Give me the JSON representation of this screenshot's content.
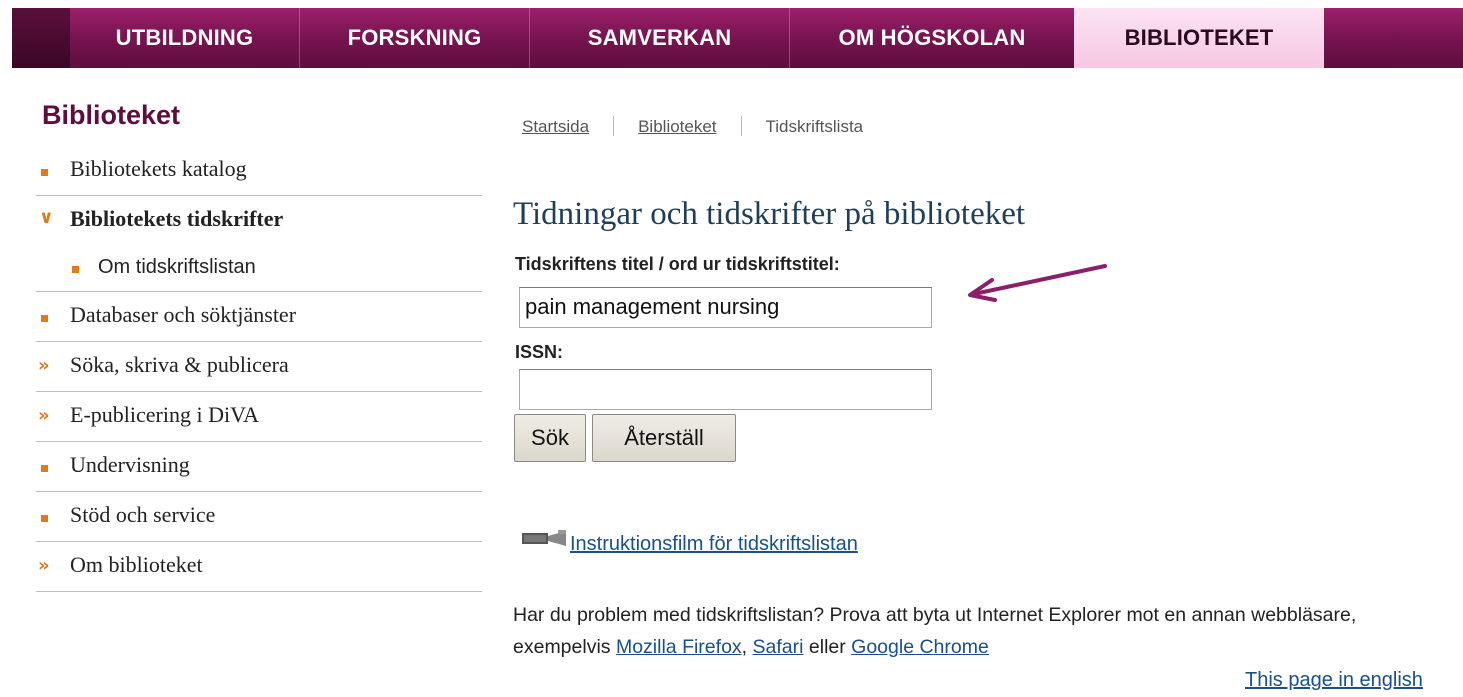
{
  "topnav": {
    "tabs": [
      {
        "label": "UTBILDNING",
        "active": false
      },
      {
        "label": "FORSKNING",
        "active": false
      },
      {
        "label": "SAMVERKAN",
        "active": false
      },
      {
        "label": "OM HÖGSKOLAN",
        "active": false
      },
      {
        "label": "BIBLIOTEKET",
        "active": true
      }
    ],
    "colors": {
      "bar": "#7a1552",
      "active_tab": "#f6c8e3"
    }
  },
  "sidebar": {
    "title": "Biblioteket",
    "items": [
      {
        "label": "Bibliotekets katalog",
        "marker": "square-bullet-icon"
      },
      {
        "label": "Bibliotekets tidskrifter",
        "marker": "chevron-down-icon",
        "expanded": true
      },
      {
        "label": "Om tidskriftslistan",
        "marker": "square-bullet-icon",
        "sub": true
      },
      {
        "label": "Databaser och söktjänster",
        "marker": "square-bullet-icon"
      },
      {
        "label": "Söka, skriva & publicera",
        "marker": "double-arrow-icon"
      },
      {
        "label": "E-publicering i DiVA",
        "marker": "double-arrow-icon"
      },
      {
        "label": "Undervisning",
        "marker": "square-bullet-icon"
      },
      {
        "label": "Stöd och service",
        "marker": "square-bullet-icon"
      },
      {
        "label": "Om biblioteket",
        "marker": "double-arrow-icon"
      }
    ]
  },
  "breadcrumb": [
    "Startsida",
    "Biblioteket",
    "Tidskriftslista"
  ],
  "main": {
    "heading": "Tidningar och tidskrifter på biblioteket",
    "title_label": "Tidskriftens titel / ord ur tidskriftstitel:",
    "title_value": "pain management nursing",
    "issn_label": "ISSN:",
    "issn_value": "",
    "search_button": "Sök",
    "reset_button": "Återställ",
    "film_link": "Instruktionsfilm för tidskriftslistan",
    "para_text": "Har du problem med tidskriftslistan? Prova att byta ut Internet Explorer mot en annan webbläsare, exempelvis",
    "browser_firefox": "Mozilla Firefox",
    "browser_safari": "Safari",
    "browser_chrome": "Google Chrome",
    "sep_comma": ",",
    "sep_eller": "eller",
    "english_link": "This page in english"
  },
  "annotation": {
    "arrow_color": "#8c1f6a",
    "icon": "annotation-arrow-icon"
  }
}
